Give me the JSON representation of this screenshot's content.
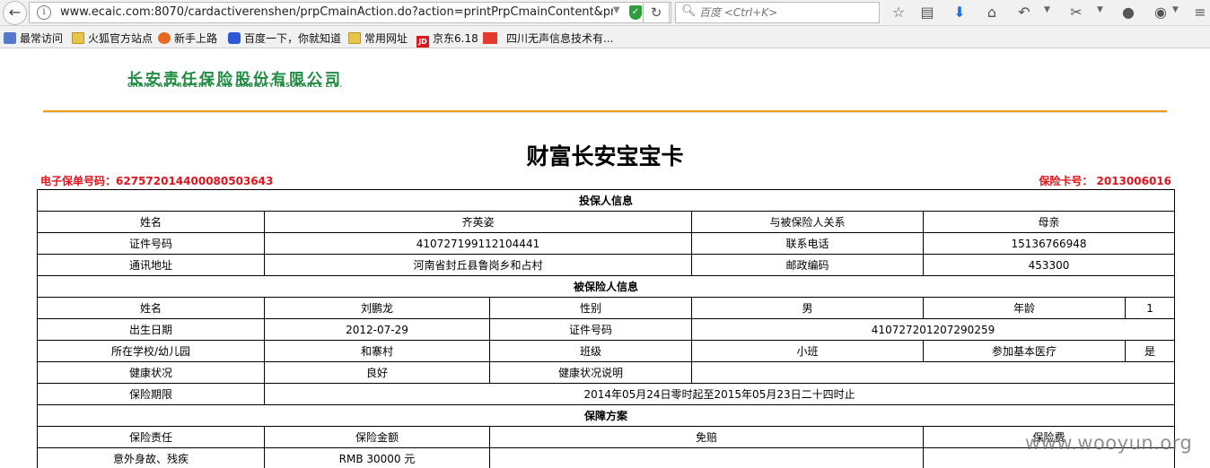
{
  "browser": {
    "url": "www.ecaic.com:8070/cardactiverenshen/prpCmainAction.do?action=printPrpCmainContent&prpCm",
    "search_placeholder": "百度 <Ctrl+K>",
    "bookmarks": [
      "最常访问",
      "火狐官方站点",
      "新手上路",
      "百度一下，你就知道",
      "常用网址",
      "京东6.18",
      "四川无声信息技术有..."
    ]
  },
  "header": {
    "company_cn": "长安责任保险股份有限公司",
    "company_en": "CHANG AN PROPERTY AND LIABILITY INSURANCE LTD."
  },
  "document": {
    "title": "财富长安宝宝卡",
    "policy_no": "电子保单号码：627572014400080503643",
    "card_no": "保险卡号： 2013006016"
  },
  "applicant": {
    "section": "投保人信息",
    "name_label": "姓名",
    "name": "齐英姿",
    "relation_label": "与被保险人关系",
    "relation": "母亲",
    "id_label": "证件号码",
    "id": "410727199112104441",
    "phone_label": "联系电话",
    "phone": "15136766948",
    "address_label": "通讯地址",
    "address": "河南省封丘县鲁岗乡和占村",
    "zip_label": "邮政编码",
    "zip": "453300"
  },
  "insured": {
    "section": "被保险人信息",
    "name_label": "姓名",
    "name": "刘鹏龙",
    "gender_label": "性别",
    "gender": "男",
    "age_label": "年龄",
    "age": "1",
    "birth_label": "出生日期",
    "birth": "2012-07-29",
    "id_label": "证件号码",
    "id": "410727201207290259",
    "school_label": "所在学校/幼儿园",
    "school": "和寨村",
    "class_label": "班级",
    "class": "小班",
    "medical_label": "参加基本医疗",
    "medical": "是",
    "health_label": "健康状况",
    "health": "良好",
    "health_desc_label": "健康状况说明",
    "health_desc": "",
    "period_label": "保险期限",
    "period": "2014年05月24日零时起至2015年05月23日二十四时止"
  },
  "plan": {
    "section": "保障方案",
    "headers": [
      "保险责任",
      "保险金额",
      "免赔",
      "保险费"
    ],
    "rows": [
      [
        "意外身故、残疾",
        "RMB 30000 元",
        "",
        ""
      ]
    ]
  },
  "watermark": "www.wooyun.org"
}
